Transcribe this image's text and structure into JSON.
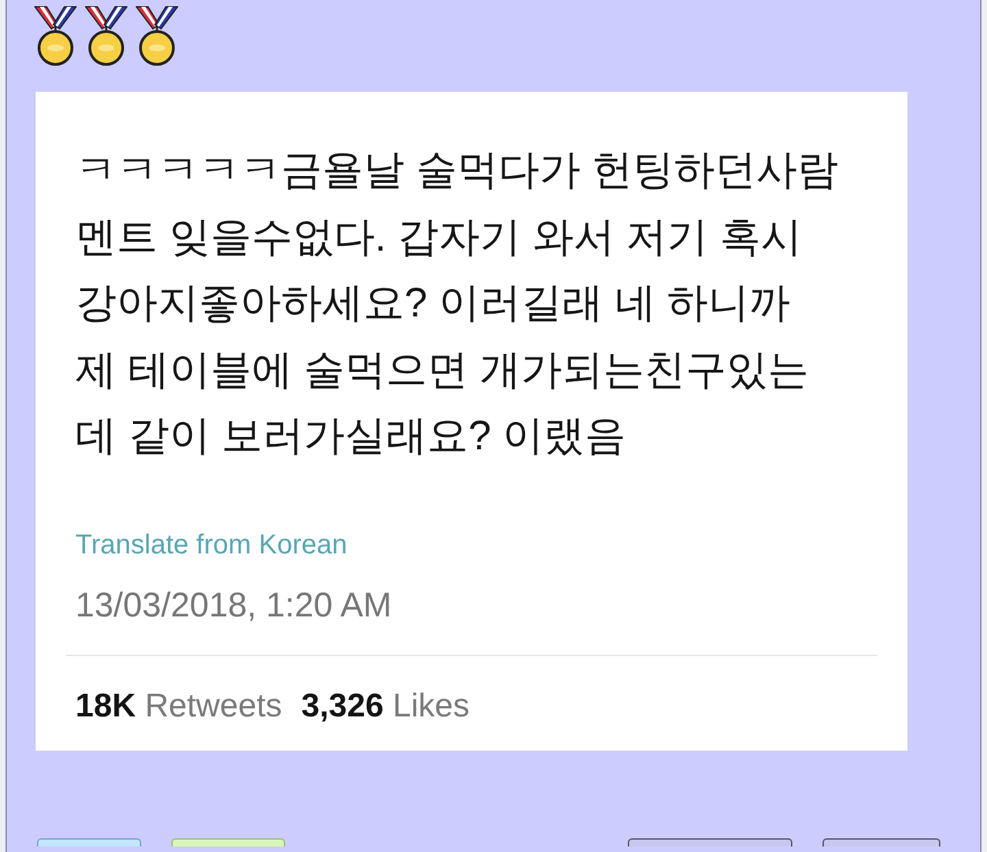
{
  "tweet": {
    "text_lines": [
      "ㅋㅋㅋㅋㅋ금욜날 술먹다가 헌팅하던사람",
      "멘트 잊을수없다. 갑자기 와서 저기 혹시",
      "강아지좋아하세요? 이러길래 네 하니까",
      "제 테이블에 술먹으면 개가되는친구있는",
      "데 같이 보러가실래요? 이랬음"
    ],
    "translate_link": "Translate from Korean",
    "timestamp": "13/03/2018, 1:20 AM",
    "stats": [
      {
        "count": "18K",
        "label": "Retweets"
      },
      {
        "count": "3,326",
        "label": "Likes"
      }
    ]
  }
}
